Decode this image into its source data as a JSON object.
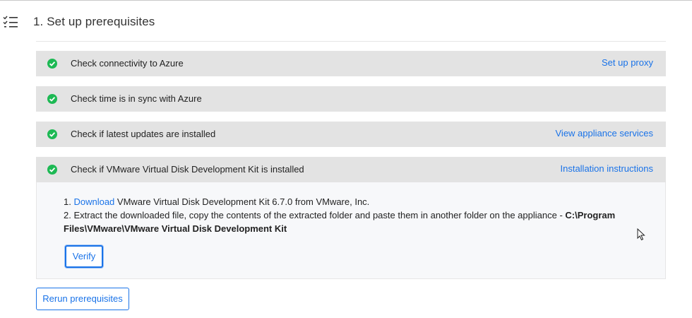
{
  "section": {
    "title": "1. Set up prerequisites",
    "icon": "checklist-icon"
  },
  "checks": [
    {
      "label": "Check connectivity to Azure",
      "status": "passed",
      "link": "Set up proxy"
    },
    {
      "label": "Check time is in sync with Azure",
      "status": "passed",
      "link": ""
    },
    {
      "label": "Check if latest updates are installed",
      "status": "passed",
      "link": "View appliance services"
    },
    {
      "label": "Check if VMware Virtual Disk Development Kit is installed",
      "status": "passed",
      "link": "Installation instructions"
    }
  ],
  "instructions": {
    "step1_prefix": "1. ",
    "step1_link": "Download",
    "step1_rest": " VMware Virtual Disk Development Kit 6.7.0 from VMware, Inc.",
    "step2_text": "2. Extract the downloaded file, copy the contents of the extracted folder and paste them in another folder on the appliance - ",
    "step2_path": "C:\\Program Files\\VMware\\VMware Virtual Disk Development Kit",
    "verify_label": "Verify"
  },
  "rerun_label": "Rerun prerequisites",
  "colors": {
    "accent": "#1a73e8",
    "success": "#1db954",
    "row_background": "#e3e3e3"
  }
}
